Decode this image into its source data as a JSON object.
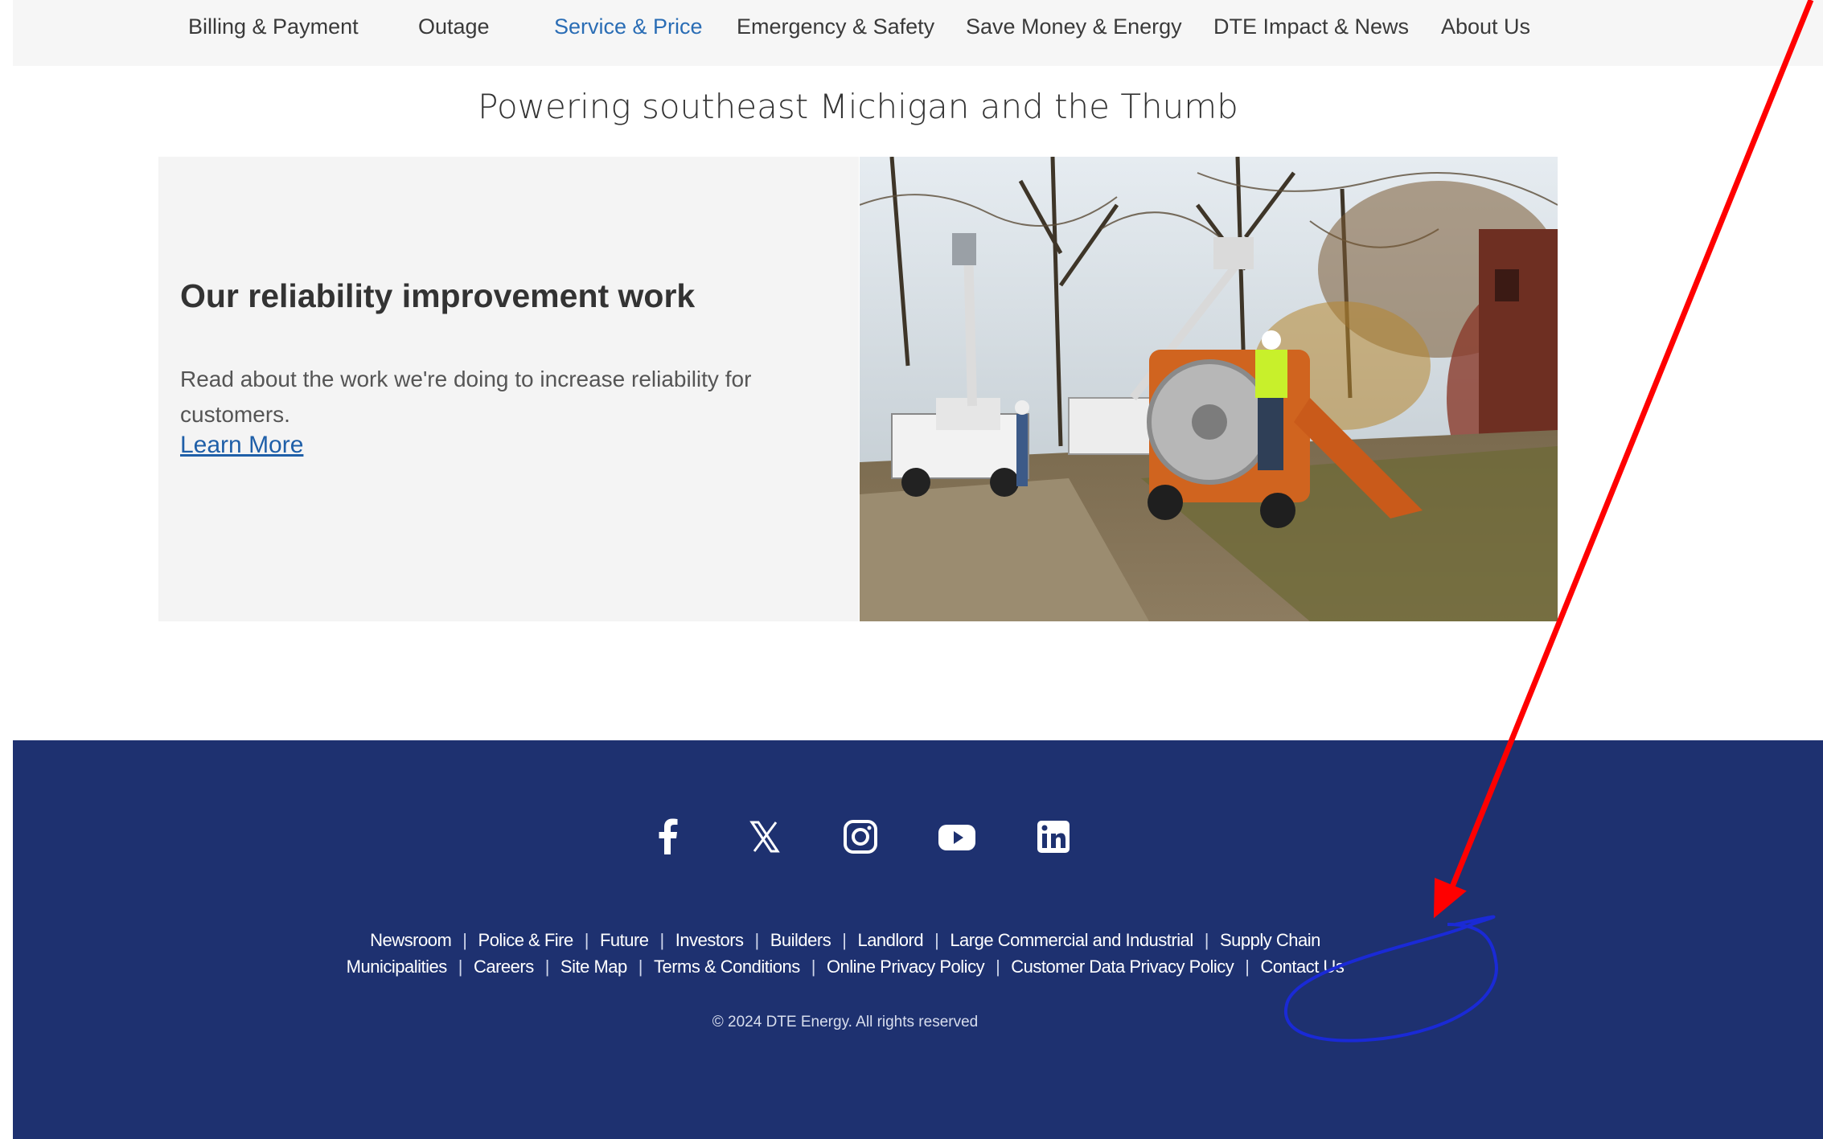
{
  "nav": {
    "items": [
      {
        "label": "Billing & Payment",
        "active": false
      },
      {
        "label": "Outage",
        "active": false
      },
      {
        "label": "Service & Price",
        "active": true
      },
      {
        "label": "Emergency & Safety",
        "active": false
      },
      {
        "label": "Save Money & Energy",
        "active": false
      },
      {
        "label": "DTE Impact & News",
        "active": false
      },
      {
        "label": "About Us",
        "active": false
      }
    ]
  },
  "tagline": "Powering southeast Michigan and the Thumb",
  "feature": {
    "title": "Our reliability improvement work",
    "body": "Read about the work we're doing to increase reliability for customers.",
    "link": "Learn More"
  },
  "footer": {
    "social": [
      "facebook-icon",
      "x-icon",
      "instagram-icon",
      "youtube-icon",
      "linkedin-icon"
    ],
    "row1": [
      "Newsroom",
      "Police & Fire",
      "Future",
      "Investors",
      "Builders",
      "Landlord",
      "Large Commercial and Industrial",
      "Supply Chain"
    ],
    "row2": [
      "Municipalities",
      "Careers",
      "Site Map",
      "Terms & Conditions",
      "Online Privacy Policy",
      "Customer Data Privacy Policy",
      "Contact Us"
    ],
    "separator": "|",
    "copyright": "© 2024 DTE Energy. All rights reserved"
  },
  "colors": {
    "footer_bg": "#1e3170",
    "nav_bg": "#f6f6f6",
    "active_nav": "#2a6db5",
    "link": "#1f5fa8",
    "annotation_arrow": "#ff0000",
    "annotation_circle": "#1a2ad6"
  }
}
